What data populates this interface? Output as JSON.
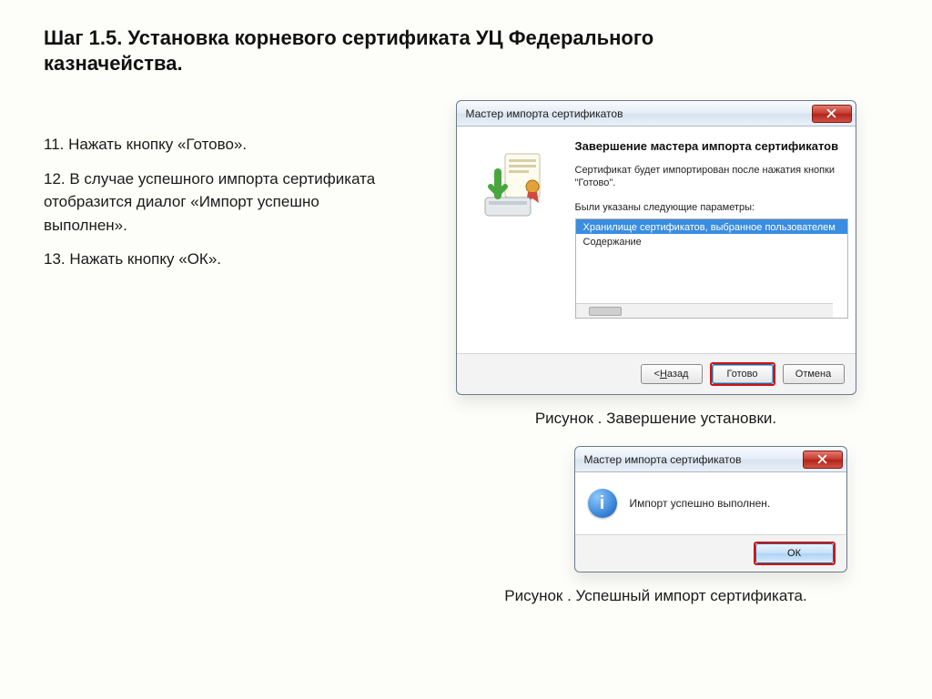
{
  "title": "Шаг 1.5. Установка корневого сертификата УЦ Федерального казначейства.",
  "instructions": {
    "i11": "11. Нажать кнопку «Готово».",
    "i12": "12. В случае успешного импорта сертификата отобразится диалог «Импорт успешно выполнен».",
    "i13": "13. Нажать кнопку «ОК»."
  },
  "wizard": {
    "window_title": "Мастер импорта сертификатов",
    "heading": "Завершение мастера импорта сертификатов",
    "body_text": "Сертификат будет импортирован после нажатия кнопки \"Готово\".",
    "list_label": "Были указаны следующие параметры:",
    "list_rows": {
      "r0": "Хранилище сертификатов, выбранное пользователем",
      "r1": "Содержание"
    },
    "buttons": {
      "back_prefix": "< ",
      "back_u": "Н",
      "back_rest": "азад",
      "finish": "Готово",
      "cancel": "Отмена"
    }
  },
  "caption1": "Рисунок . Завершение установки.",
  "msgbox": {
    "window_title": "Мастер импорта сертификатов",
    "message": "Импорт успешно выполнен.",
    "ok": "ОК"
  },
  "caption2": "Рисунок . Успешный импорт сертификата."
}
